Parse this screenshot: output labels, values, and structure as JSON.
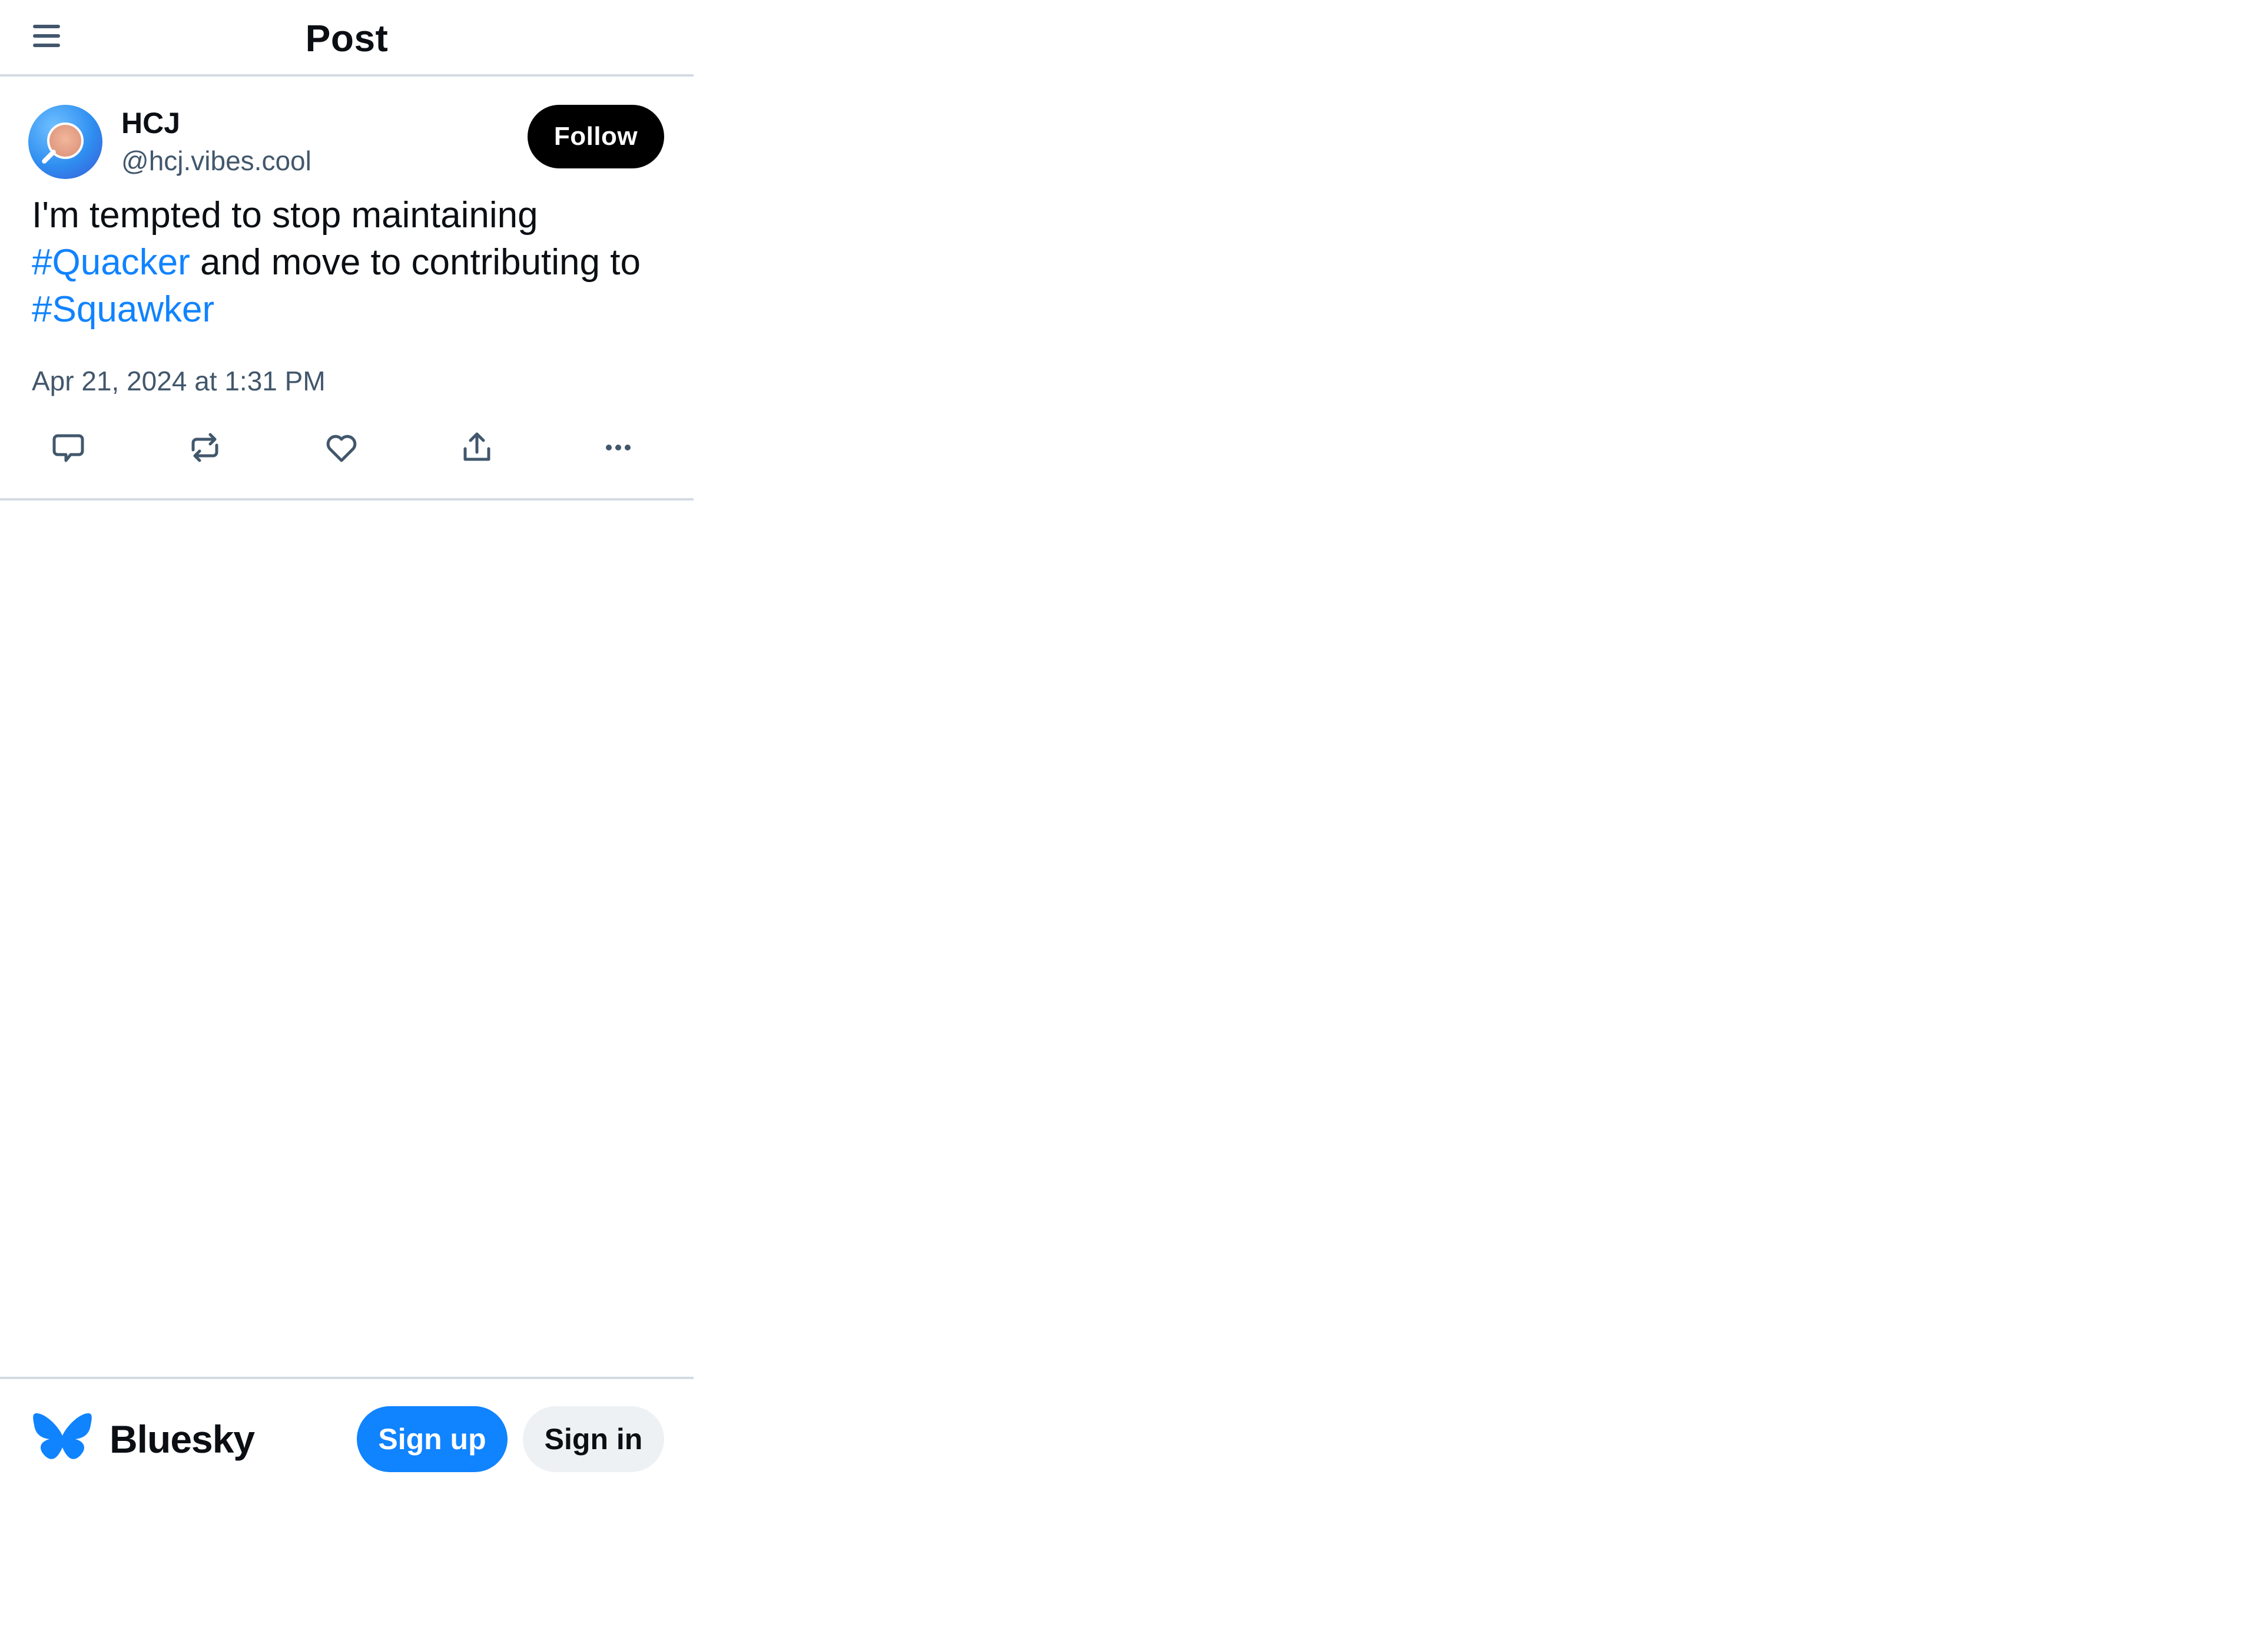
{
  "header": {
    "title": "Post",
    "menu_icon": "menu-icon"
  },
  "post": {
    "author": {
      "display_name": "HCJ",
      "handle": "@hcj.vibes.cool"
    },
    "follow_label": "Follow",
    "text": {
      "part1": "I'm tempted to stop maintaining ",
      "hashtag1": "#Quacker",
      "part2": " and move to contributing to ",
      "hashtag2": "#Squawker"
    },
    "timestamp": "Apr 21, 2024 at 1:31 PM",
    "actions": [
      "reply-icon",
      "repost-icon",
      "like-icon",
      "share-icon",
      "more-icon"
    ]
  },
  "footer": {
    "brand": "Bluesky",
    "signup_label": "Sign up",
    "signin_label": "Sign in"
  },
  "colors": {
    "accent": "#1083fe",
    "text": "#0b0f14",
    "muted": "#42576c",
    "border": "#d4dbe2",
    "follow_bg": "#000000",
    "signin_bg": "#eef1f4"
  }
}
